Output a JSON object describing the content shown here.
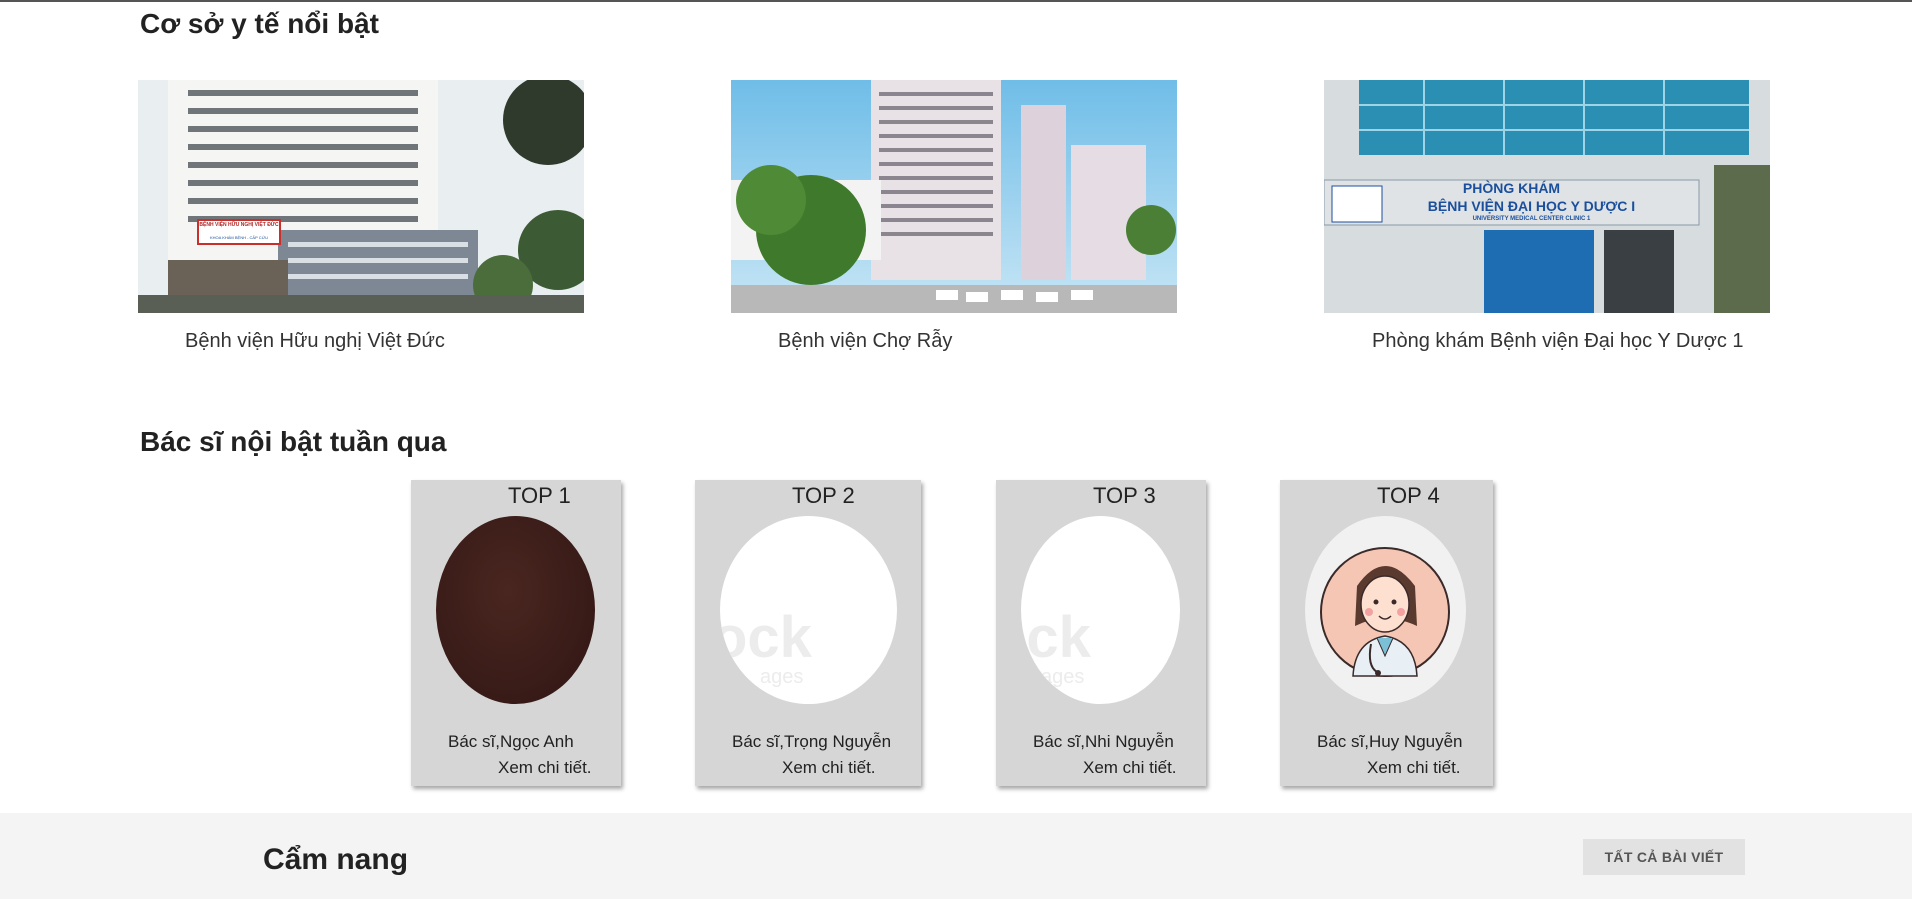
{
  "facilities": {
    "title": "Cơ sở y tế nổi bật",
    "items": [
      {
        "name": "Bệnh viện Hữu nghị Việt Đức",
        "sign_text": "BỆNH VIỆN HỮU NGHỊ VIỆT ĐỨC",
        "sign_sub": "KHOA KHÁM BỆNH - CẤP CỨU"
      },
      {
        "name": "Bệnh viện Chợ Rẫy"
      },
      {
        "name": "Phòng khám Bệnh viện Đại học Y Dược 1",
        "sign_line1": "PHÒNG KHÁM",
        "sign_line2": "BỆNH VIỆN ĐẠI HỌC Y DƯỢC I",
        "sign_line3": "UNIVERSITY MEDICAL CENTER CLINIC 1"
      }
    ]
  },
  "doctors": {
    "title": "Bác sĩ nội bật tuần qua",
    "items": [
      {
        "rank": "TOP 1",
        "name": "Bác sĩ,Ngọc Anh",
        "more": "Xem chi tiết."
      },
      {
        "rank": "TOP 2",
        "name": "Bác sĩ,Trọng Nguyễn",
        "more": "Xem chi tiết.",
        "watermark": "ock",
        "watermark_sub": "ages"
      },
      {
        "rank": "TOP 3",
        "name": "Bác sĩ,Nhi Nguyễn",
        "more": "Xem chi tiết.",
        "watermark": "ock",
        "watermark_sub": "ages"
      },
      {
        "rank": "TOP 4",
        "name": "Bác sĩ,Huy Nguyễn",
        "more": "Xem chi tiết."
      }
    ]
  },
  "guide": {
    "title": "Cẩm nang",
    "all_posts_label": "TẤT CẢ BÀI VIẾT"
  },
  "colors": {
    "card_bg": "#d6d6d6",
    "guide_bg": "#f4f4f4",
    "button_bg": "#e2e2e2",
    "sign_blue": "#1b4f9c"
  },
  "icons": {
    "doctor_avatar": "doctor-cartoon-icon"
  }
}
